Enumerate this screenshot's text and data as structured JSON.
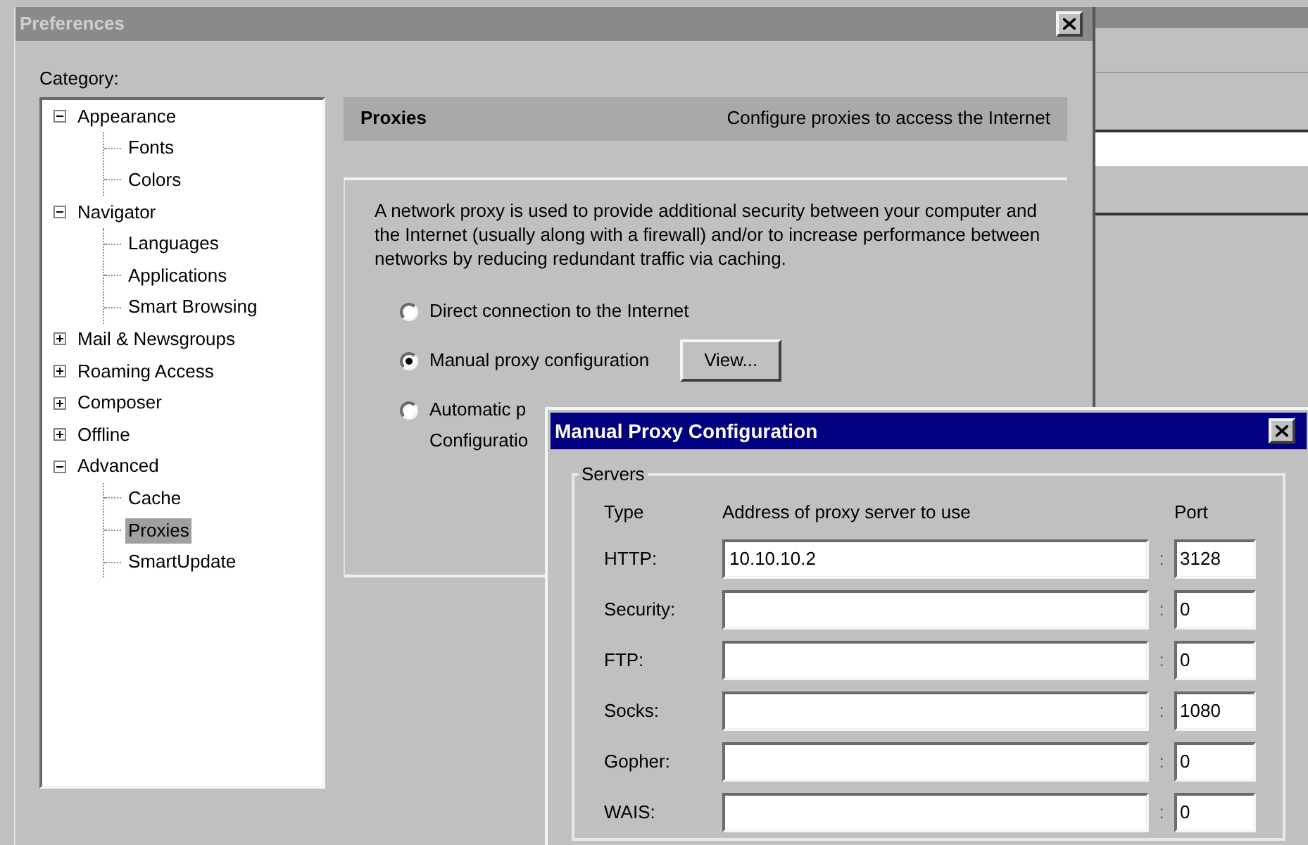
{
  "preferences": {
    "title": "Preferences",
    "category_label": "Category:",
    "tree": [
      {
        "label": "Appearance",
        "expanded": true,
        "selected": false,
        "children": [
          {
            "label": "Fonts",
            "selected": false
          },
          {
            "label": "Colors",
            "selected": false
          }
        ]
      },
      {
        "label": "Navigator",
        "expanded": true,
        "selected": false,
        "children": [
          {
            "label": "Languages",
            "selected": false
          },
          {
            "label": "Applications",
            "selected": false
          },
          {
            "label": "Smart Browsing",
            "selected": false
          }
        ]
      },
      {
        "label": "Mail & Newsgroups",
        "expanded": false,
        "selected": false
      },
      {
        "label": "Roaming Access",
        "expanded": false,
        "selected": false
      },
      {
        "label": "Composer",
        "expanded": false,
        "selected": false
      },
      {
        "label": "Offline",
        "expanded": false,
        "selected": false
      },
      {
        "label": "Advanced",
        "expanded": true,
        "selected": false,
        "children": [
          {
            "label": "Cache",
            "selected": false
          },
          {
            "label": "Proxies",
            "selected": true
          },
          {
            "label": "SmartUpdate",
            "selected": false
          }
        ]
      }
    ],
    "panel": {
      "title": "Proxies",
      "subtitle": "Configure proxies to access the Internet",
      "description": "A network proxy is used to provide additional security between your computer and the Internet (usually along with a firewall) and/or to increase performance between networks by reducing redundant traffic via caching.",
      "options": [
        {
          "label": "Direct connection to the Internet",
          "selected": false
        },
        {
          "label": "Manual proxy configuration",
          "selected": true,
          "button": "View..."
        },
        {
          "label": "Automatic p",
          "selected": false,
          "second_line": "Configuratio"
        }
      ]
    }
  },
  "dialog": {
    "title": "Manual Proxy Configuration",
    "group": "Servers",
    "columns": [
      "Type",
      "Address of proxy server to use",
      "Port"
    ],
    "rows": [
      {
        "type": "HTTP:",
        "address": "10.10.10.2",
        "separator": ":",
        "port": "3128"
      },
      {
        "type": "Security:",
        "separator": ":",
        "port": "0"
      },
      {
        "type": "FTP:",
        "separator": ":",
        "port": "0"
      },
      {
        "type": "Socks:",
        "separator": ":",
        "port": "1080"
      },
      {
        "type": "Gopher:",
        "separator": ":",
        "port": "0"
      },
      {
        "type": "WAIS:",
        "separator": ":",
        "port": "0"
      }
    ]
  }
}
